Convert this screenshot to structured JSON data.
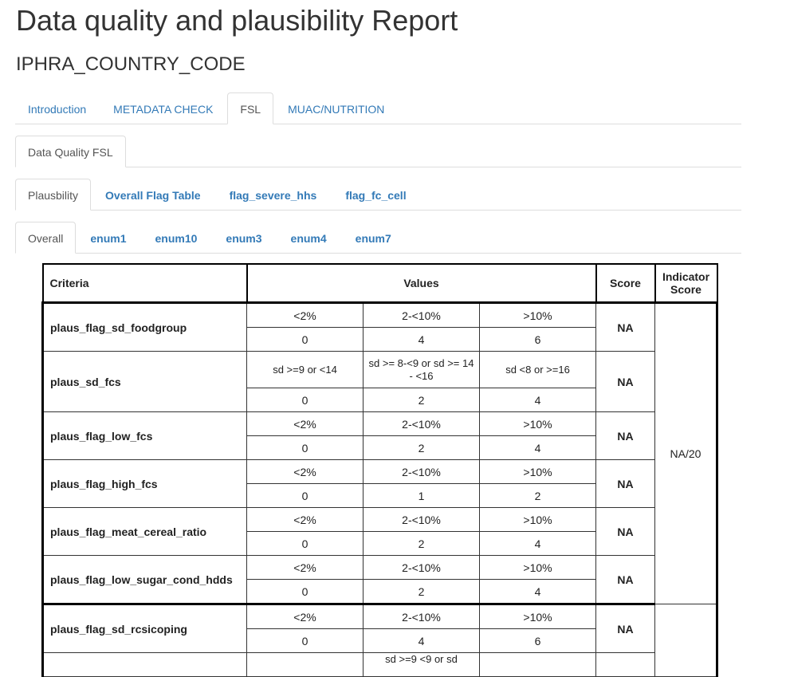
{
  "page": {
    "title": "Data quality and plausibility Report",
    "subtitle": "IPHRA_COUNTRY_CODE"
  },
  "tabs_main": [
    {
      "label": "Introduction",
      "active": false
    },
    {
      "label": "METADATA CHECK",
      "active": false
    },
    {
      "label": "FSL",
      "active": true
    },
    {
      "label": "MUAC/NUTRITION",
      "active": false
    }
  ],
  "tabs_sub": [
    {
      "label": "Data Quality FSL",
      "active": true
    }
  ],
  "tabs_plaus": [
    {
      "label": "Plausbility",
      "active": true
    },
    {
      "label": "Overall Flag Table",
      "active": false
    },
    {
      "label": "flag_severe_hhs",
      "active": false
    },
    {
      "label": "flag_fc_cell",
      "active": false
    }
  ],
  "tabs_enum": [
    {
      "label": "Overall",
      "active": true
    },
    {
      "label": "enum1",
      "active": false
    },
    {
      "label": "enum10",
      "active": false
    },
    {
      "label": "enum3",
      "active": false
    },
    {
      "label": "enum4",
      "active": false
    },
    {
      "label": "enum7",
      "active": false
    }
  ],
  "table": {
    "headers": {
      "criteria": "Criteria",
      "values": "Values",
      "score": "Score",
      "indicator_score": "Indicator Score"
    },
    "indicator_score_value": "NA/20",
    "rows": [
      {
        "criteria": "plaus_flag_sd_foodgroup",
        "thresholds": [
          "<2%",
          "2-<10%",
          ">10%"
        ],
        "points": [
          "0",
          "4",
          "6"
        ],
        "score": "NA"
      },
      {
        "criteria": "plaus_sd_fcs",
        "thresholds": [
          "sd >=9 or <14",
          "sd >= 8-<9 or sd >= 14 - <16",
          "sd <8 or >=16"
        ],
        "points": [
          "0",
          "2",
          "4"
        ],
        "score": "NA"
      },
      {
        "criteria": "plaus_flag_low_fcs",
        "thresholds": [
          "<2%",
          "2-<10%",
          ">10%"
        ],
        "points": [
          "0",
          "2",
          "4"
        ],
        "score": "NA"
      },
      {
        "criteria": "plaus_flag_high_fcs",
        "thresholds": [
          "<2%",
          "2-<10%",
          ">10%"
        ],
        "points": [
          "0",
          "1",
          "2"
        ],
        "score": "NA"
      },
      {
        "criteria": "plaus_flag_meat_cereal_ratio",
        "thresholds": [
          "<2%",
          "2-<10%",
          ">10%"
        ],
        "points": [
          "0",
          "2",
          "4"
        ],
        "score": "NA"
      },
      {
        "criteria": "plaus_flag_low_sugar_cond_hdds",
        "thresholds": [
          "<2%",
          "2-<10%",
          ">10%"
        ],
        "points": [
          "0",
          "2",
          "4"
        ],
        "score": "NA"
      },
      {
        "criteria": "plaus_flag_sd_rcsicoping",
        "thresholds": [
          "<2%",
          "2-<10%",
          ">10%"
        ],
        "points": [
          "0",
          "4",
          "6"
        ],
        "score": "NA"
      }
    ],
    "partial_next_row_value": "sd >=9 <9 or sd"
  }
}
